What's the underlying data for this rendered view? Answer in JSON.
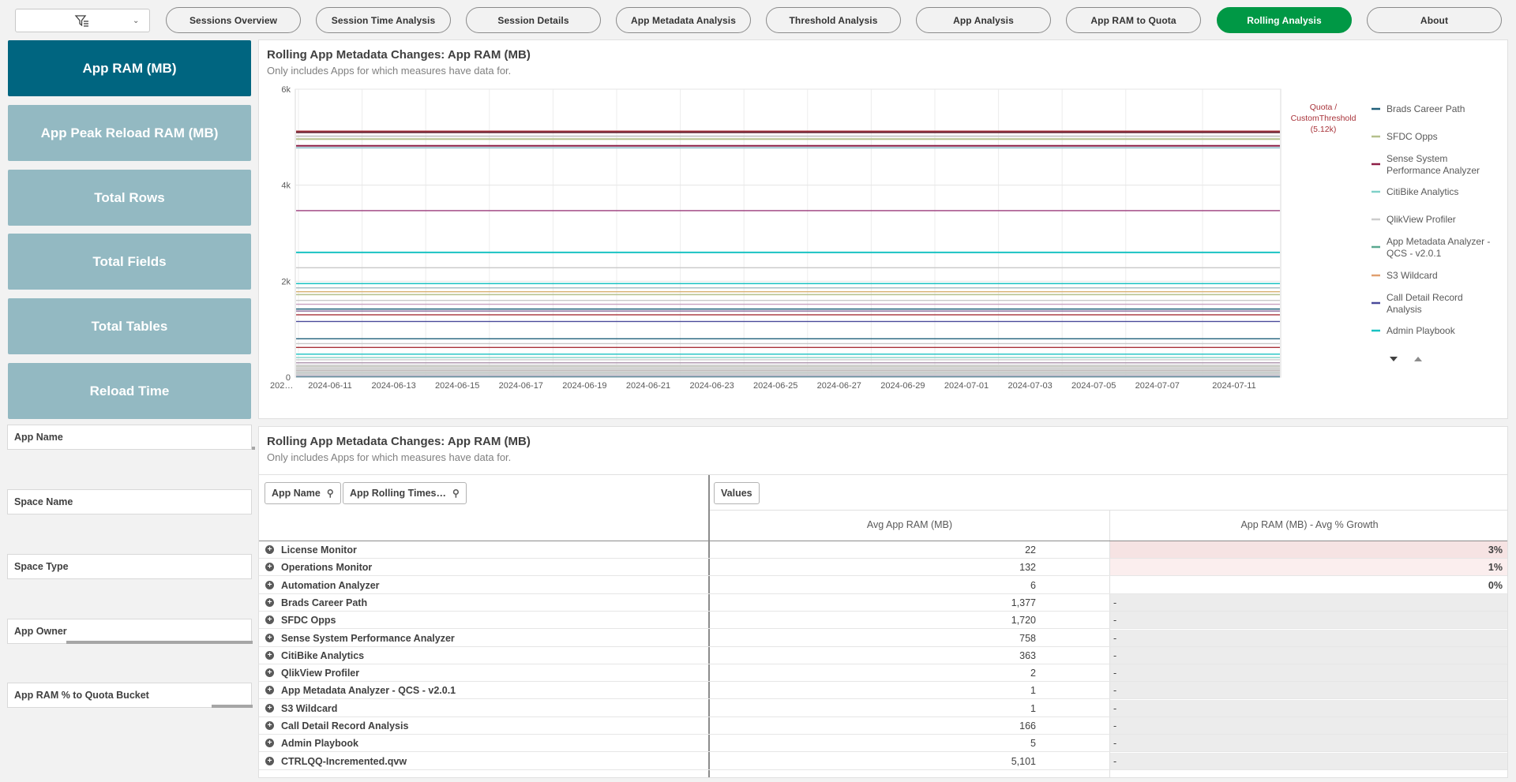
{
  "toolbar": {
    "tabs": [
      "Sessions Overview",
      "Session Time Analysis",
      "Session Details",
      "App Metadata Analysis",
      "Threshold Analysis",
      "App Analysis",
      "App RAM to Quota",
      "Rolling Analysis",
      "About"
    ],
    "active_tab": "Rolling Analysis",
    "active_color": "#009845"
  },
  "sidebar": {
    "measures": [
      "App RAM (MB)",
      "App Peak Reload RAM (MB)",
      "Total Rows",
      "Total Fields",
      "Total Tables",
      "Reload Time"
    ],
    "active_measure": "App RAM (MB)",
    "active_color": "#006580",
    "inactive_color": "#93b9c2",
    "filters": [
      "App Name",
      "Space Name",
      "Space Type",
      "App Owner",
      "App RAM % to Quota Bucket"
    ]
  },
  "chart_panel": {
    "title": "Rolling App Metadata Changes: App RAM (MB)",
    "subtitle": "Only includes Apps for which measures have data for."
  },
  "chart_data": {
    "type": "line",
    "y_ticks": [
      "0",
      "2k",
      "4k",
      "6k"
    ],
    "ylim": [
      0,
      6000
    ],
    "x_ticks": [
      "202…",
      "2024-06-11",
      "2024-06-13",
      "2024-06-15",
      "2024-06-17",
      "2024-06-19",
      "2024-06-21",
      "2024-06-23",
      "2024-06-25",
      "2024-06-27",
      "2024-06-29",
      "2024-07-01",
      "2024-07-03",
      "2024-07-05",
      "2024-07-07",
      "2024-07-11"
    ],
    "reference_line": {
      "label_line1": "Quota /",
      "label_line2": "CustomThreshold",
      "label_line3": "(5.12k)",
      "value": 5120,
      "color": "#a83239"
    },
    "legend": [
      {
        "name": "Brads Career Path",
        "color": "#1f5f7a"
      },
      {
        "name": "SFDC Opps",
        "color": "#b5c08c"
      },
      {
        "name": "Sense System Performance Analyzer",
        "color": "#8e1f47"
      },
      {
        "name": "CitiBike Analytics",
        "color": "#7fd1c8"
      },
      {
        "name": "QlikView Profiler",
        "color": "#cccccc"
      },
      {
        "name": "App Metadata Analyzer - QCS - v2.0.1",
        "color": "#5aa88f"
      },
      {
        "name": "S3 Wildcard",
        "color": "#e0a070"
      },
      {
        "name": "Call Detail Record Analysis",
        "color": "#4a4a9a"
      },
      {
        "name": "Admin Playbook",
        "color": "#19c2c2"
      }
    ],
    "series_levels": [
      {
        "value": 5120,
        "color": "#a83239"
      },
      {
        "value": 5101,
        "color": "#6e2b3a"
      },
      {
        "value": 5020,
        "color": "#c9c9c9"
      },
      {
        "value": 4960,
        "color": "#b5c08c"
      },
      {
        "value": 4820,
        "color": "#8e1f47"
      },
      {
        "value": 4780,
        "color": "#9fc5d0"
      },
      {
        "value": 3470,
        "color": "#9a3a7a"
      },
      {
        "value": 2600,
        "color": "#19c2c2"
      },
      {
        "value": 2280,
        "color": "#c9c9c9"
      },
      {
        "value": 1950,
        "color": "#19c2c2"
      },
      {
        "value": 1860,
        "color": "#9fb9c0"
      },
      {
        "value": 1780,
        "color": "#d8b070"
      },
      {
        "value": 1720,
        "color": "#b5c08c"
      },
      {
        "value": 1600,
        "color": "#c9c9c9"
      },
      {
        "value": 1520,
        "color": "#c8a0c0"
      },
      {
        "value": 1420,
        "color": "#1f5f7a"
      },
      {
        "value": 1377,
        "color": "#8a6a9a"
      },
      {
        "value": 1300,
        "color": "#a83239"
      },
      {
        "value": 1160,
        "color": "#4a4a9a"
      },
      {
        "value": 800,
        "color": "#1f5f7a"
      },
      {
        "value": 700,
        "color": "#c9c9c9"
      },
      {
        "value": 620,
        "color": "#a83239"
      },
      {
        "value": 480,
        "color": "#19c2c2"
      },
      {
        "value": 410,
        "color": "#7fd1c8"
      },
      {
        "value": 363,
        "color": "#cccccc"
      },
      {
        "value": 300,
        "color": "#b09ab0"
      },
      {
        "value": 230,
        "color": "#b5c08c"
      },
      {
        "value": 166,
        "color": "#c9c9c9"
      },
      {
        "value": 132,
        "color": "#8e6a6a"
      },
      {
        "value": 90,
        "color": "#5aa88f"
      },
      {
        "value": 40,
        "color": "#4a4a9a"
      },
      {
        "value": 10,
        "color": "#1f5f7a"
      }
    ]
  },
  "table_panel": {
    "title": "Rolling App Metadata Changes: App RAM (MB)",
    "subtitle": "Only includes Apps for which measures have data for.",
    "dim_buttons": [
      "App Name",
      "App Rolling Times…"
    ],
    "values_button": "Values",
    "columns": [
      "Avg App RAM (MB)",
      "App RAM (MB) - Avg % Growth"
    ],
    "rows": [
      {
        "name": "License Monitor",
        "avg": "22",
        "growth": "3%"
      },
      {
        "name": "Operations Monitor",
        "avg": "132",
        "growth": "1%"
      },
      {
        "name": "Automation Analyzer",
        "avg": "6",
        "growth": "0%"
      },
      {
        "name": "Brads Career Path",
        "avg": "1,377",
        "growth": "-"
      },
      {
        "name": "SFDC Opps",
        "avg": "1,720",
        "growth": "-"
      },
      {
        "name": "Sense System Performance Analyzer",
        "avg": "758",
        "growth": "-"
      },
      {
        "name": "CitiBike Analytics",
        "avg": "363",
        "growth": "-"
      },
      {
        "name": "QlikView Profiler",
        "avg": "2",
        "growth": "-"
      },
      {
        "name": "App Metadata Analyzer - QCS - v2.0.1",
        "avg": "1",
        "growth": "-"
      },
      {
        "name": "S3 Wildcard",
        "avg": "1",
        "growth": "-"
      },
      {
        "name": "Call Detail Record Analysis",
        "avg": "166",
        "growth": "-"
      },
      {
        "name": "Admin Playbook",
        "avg": "5",
        "growth": "-"
      },
      {
        "name": "CTRLQQ-Incremented.qvw",
        "avg": "5,101",
        "growth": "-"
      }
    ]
  }
}
